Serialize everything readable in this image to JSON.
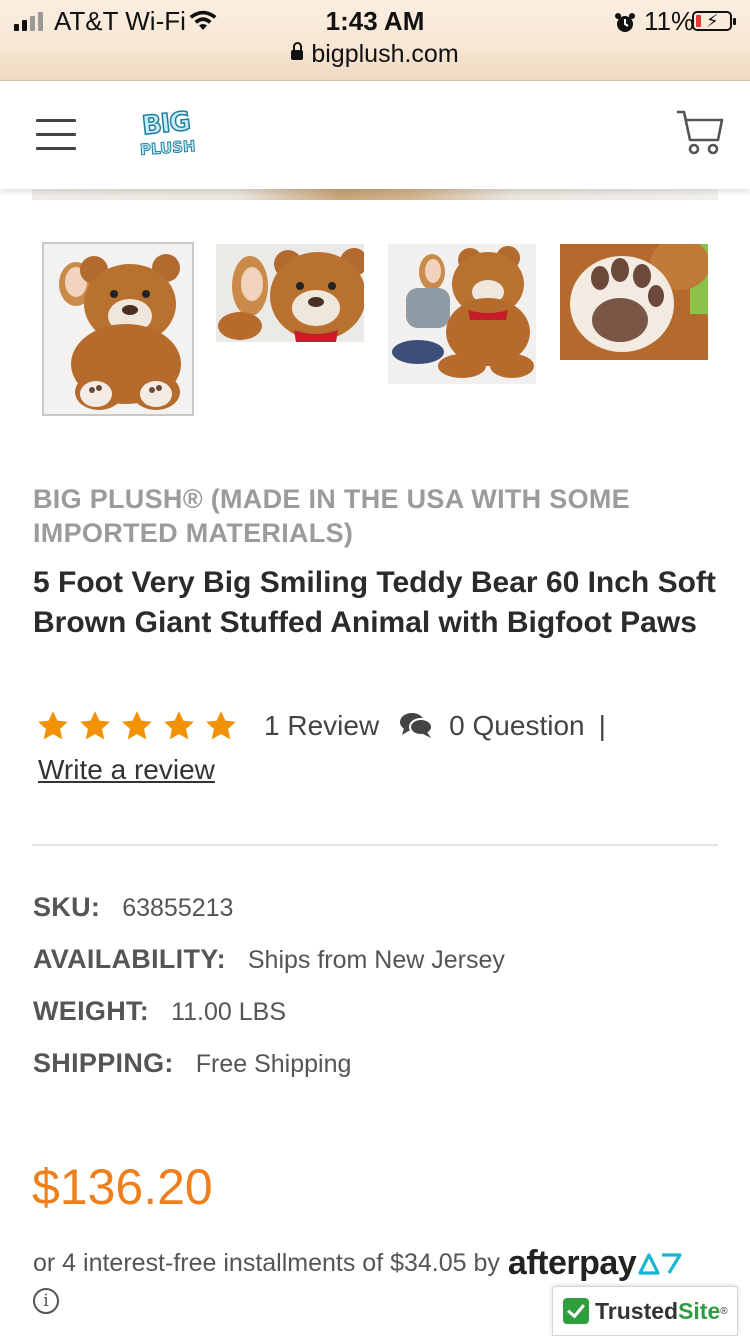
{
  "status_bar": {
    "carrier": "AT&T Wi-Fi",
    "time": "1:43 AM",
    "battery_percent": "11%",
    "battery_level": 0.11,
    "url": "bigplush.com"
  },
  "header": {
    "logo_line1": "BIG",
    "logo_line2": "PLUSH"
  },
  "thumbnails": [
    {
      "label": "bear-with-girl-sitting",
      "selected": true
    },
    {
      "label": "bear-head-with-girl",
      "selected": false
    },
    {
      "label": "girl-hugging-bear",
      "selected": false
    },
    {
      "label": "bear-paw-closeup",
      "selected": false
    }
  ],
  "product": {
    "brand": "BIG PLUSH® (MADE IN THE USA WITH SOME IMPORTED MATERIALS)",
    "title": "5 Foot Very Big Smiling Teddy Bear 60 Inch Soft Brown Giant Stuffed Animal with Bigfoot Paws",
    "rating_stars": 5,
    "review_count": "1 Review",
    "question_count": "0 Question",
    "separator": "|",
    "write_review": "Write a review",
    "specs": {
      "sku_label": "SKU:",
      "sku_value": "63855213",
      "availability_label": "AVAILABILITY:",
      "availability_value": "Ships from New Jersey",
      "weight_label": "WEIGHT:",
      "weight_value": "11.00 LBS",
      "shipping_label": "SHIPPING:",
      "shipping_value": "Free Shipping"
    },
    "price": "$136.20",
    "installments_text": "or 4 interest-free installments of $34.05 by",
    "afterpay_logo": "afterpay"
  },
  "trusted_badge": {
    "part1": "Trusted",
    "part2": "Site",
    "mark": "®"
  },
  "colors": {
    "price": "#ef7f1a",
    "star": "#f39200",
    "trusted_green": "#2e9e3e"
  }
}
